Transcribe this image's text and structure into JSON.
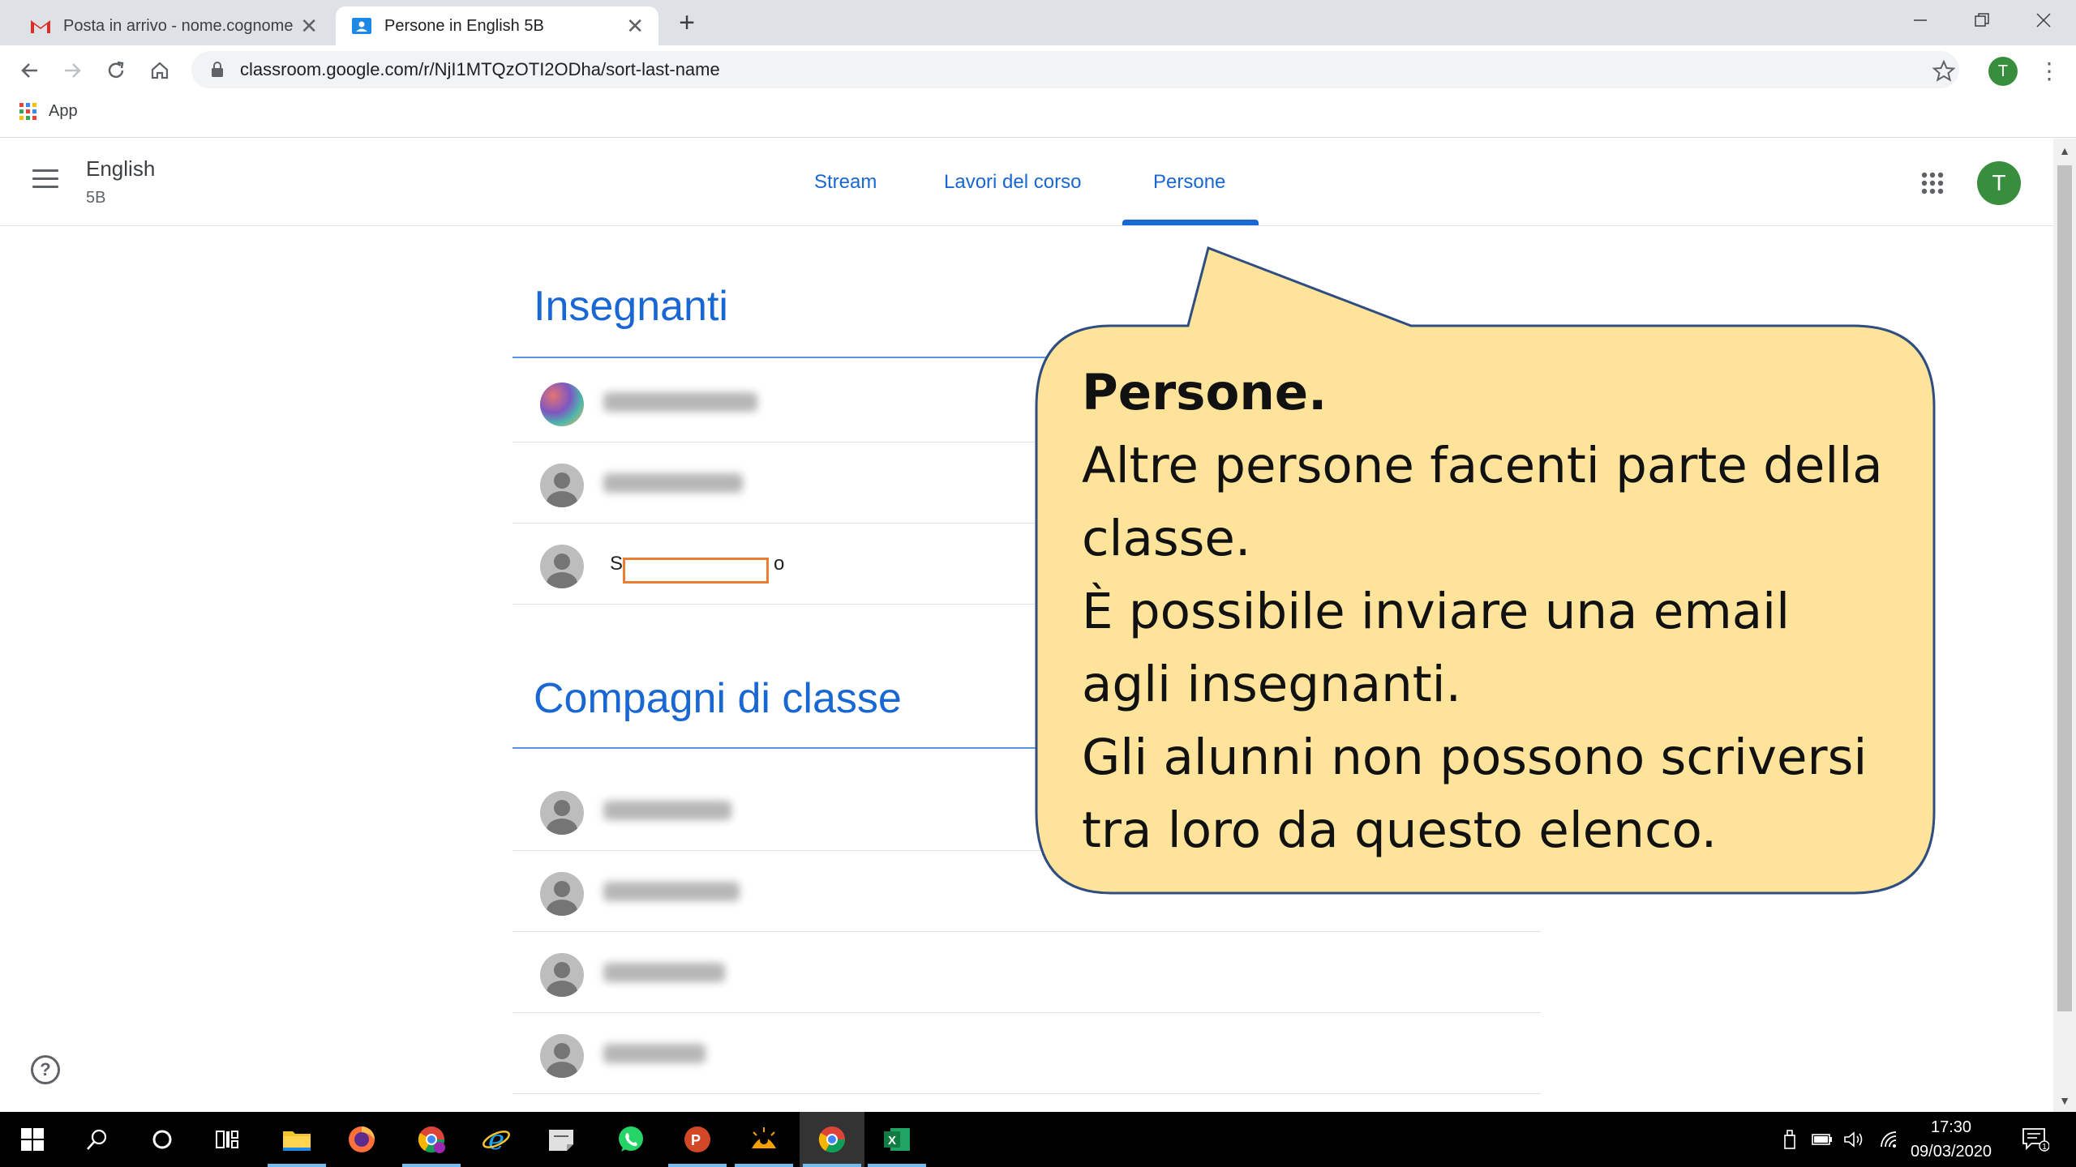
{
  "browser": {
    "tabs": [
      {
        "title": "Posta in arrivo - nome.cognome@",
        "icon": "gmail-icon",
        "active": false
      },
      {
        "title": "Persone in English 5B",
        "icon": "classroom-icon",
        "active": true
      }
    ],
    "new_tab_label": "+",
    "url": "classroom.google.com/r/NjI1MTQzOTI2ODha/sort-last-name",
    "profile_initial": "T",
    "bookmarks": [
      {
        "label": "App",
        "icon": "apps-grid-icon"
      }
    ]
  },
  "classroom": {
    "class_name": "English",
    "section": "5B",
    "tabs": [
      {
        "label": "Stream",
        "selected": false
      },
      {
        "label": "Lavori del corso",
        "selected": false
      },
      {
        "label": "Persone",
        "selected": true
      }
    ],
    "avatar_initial": "T",
    "teachers_heading": "Insegnanti",
    "teachers": [
      {
        "name_visible_start": "",
        "name_visible_end": "",
        "blurred": true,
        "avatar": "photo"
      },
      {
        "name_visible_start": "",
        "name_visible_end": "",
        "blurred": true,
        "avatar": "default"
      },
      {
        "name_visible_start": "S",
        "name_visible_end": "o",
        "blurred": false,
        "redacted": true,
        "avatar": "default"
      }
    ],
    "classmates_heading": "Compagni di classe",
    "classmates": [
      {
        "blurred": true,
        "avatar": "default"
      },
      {
        "blurred": true,
        "avatar": "default"
      },
      {
        "blurred": true,
        "avatar": "default"
      },
      {
        "blurred": true,
        "avatar": "default"
      }
    ],
    "help_label": "?"
  },
  "callout": {
    "title": "Persone.",
    "lines": [
      "Altre persone facenti parte della",
      "classe.",
      "È possibile inviare una email",
      "agli  insegnanti.",
      "Gli alunni non possono scriversi",
      "tra loro da questo elenco."
    ],
    "fill_color": "#fde49a",
    "border_color": "#2f4d80"
  },
  "taskbar": {
    "time": "17:30",
    "date": "09/03/2020",
    "apps": [
      "file-explorer-icon",
      "firefox-icon",
      "chrome-profile-icon",
      "internet-explorer-icon",
      "sticky-notes-icon",
      "whatsapp-icon",
      "powerpoint-icon",
      "photos-icon",
      "chrome-icon",
      "excel-icon"
    ]
  },
  "colors": {
    "accent": "#1967d2",
    "redaction_border": "#ed7d31",
    "avatar_green": "#388e3c"
  }
}
